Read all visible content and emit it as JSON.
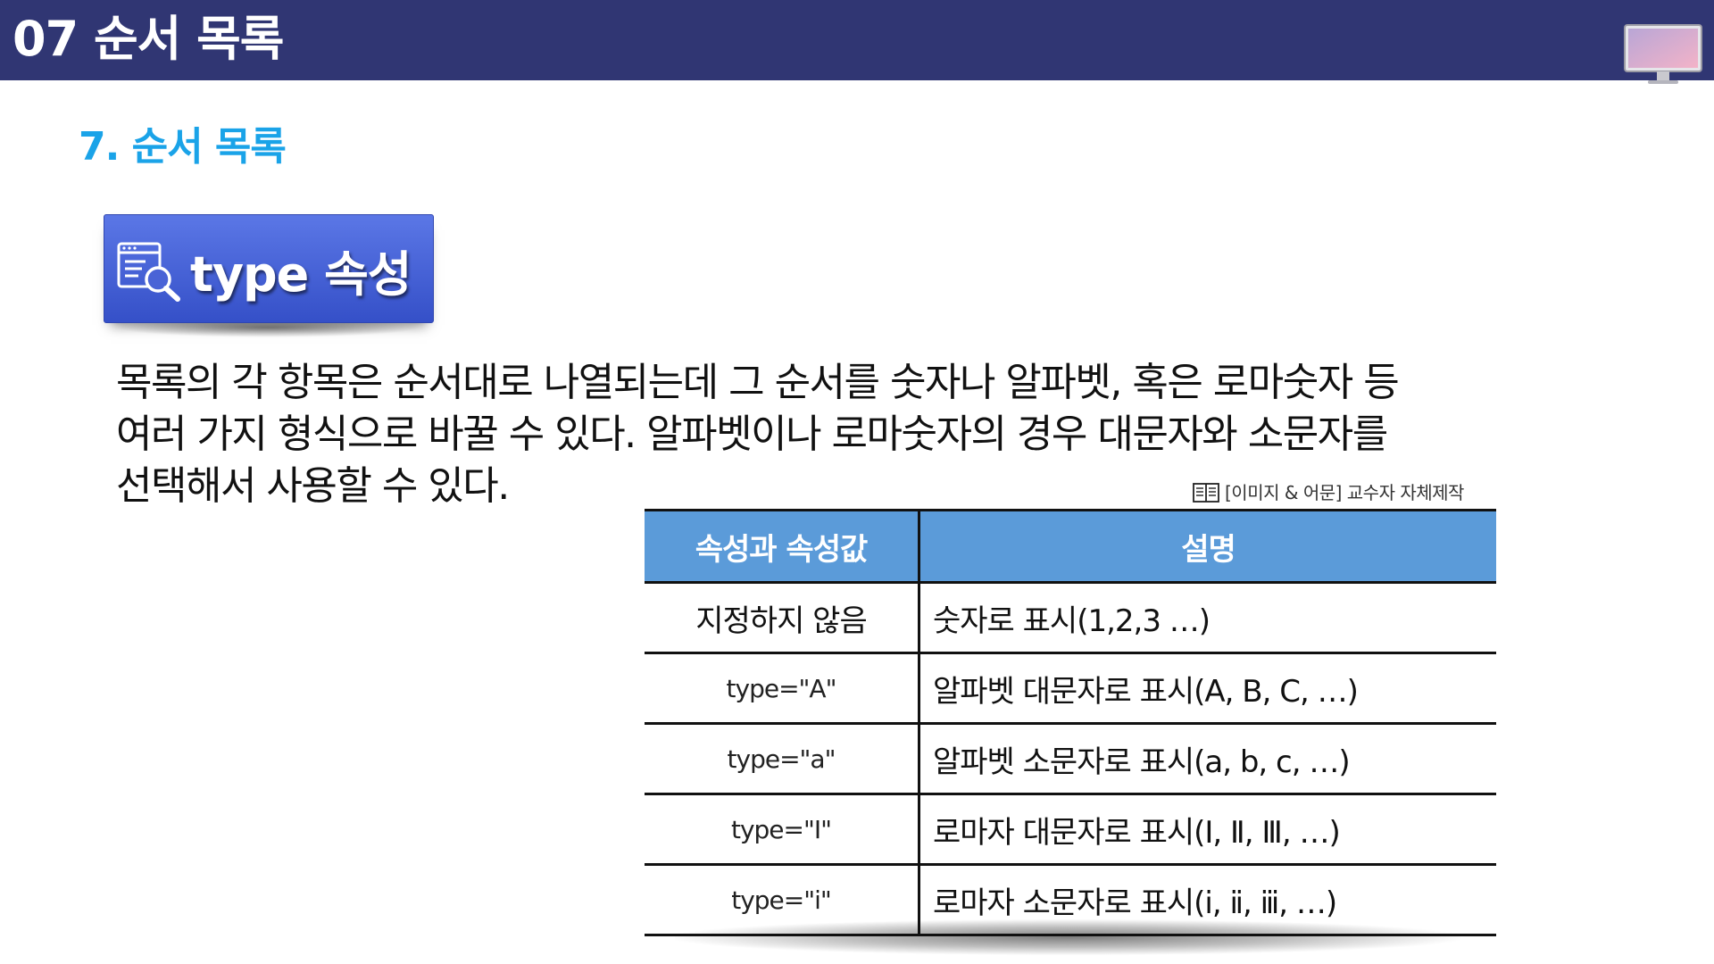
{
  "header": {
    "title": "07 순서 목록",
    "icon": "monitor-icon"
  },
  "section": {
    "title": "7. 순서 목록"
  },
  "badge": {
    "label": "type 속성",
    "icon": "document-search-icon",
    "color": "#4a63d6"
  },
  "body": {
    "lines": [
      "목록의 각 항목은 순서대로 나열되는데 그 순서를 숫자나 알파벳, 혹은 로마숫자 등",
      "여러 가지 형식으로 바꿀 수 있다. 알파벳이나 로마숫자의 경우 대문자와 소문자를",
      "선택해서 사용할 수 있다."
    ]
  },
  "source": {
    "text": "[이미지 & 어문] 교수자 자체제작",
    "icon": "book-icon"
  },
  "table": {
    "headers": [
      "속성과 속성값",
      "설명"
    ],
    "header_color": "#5b9bd9",
    "rows": [
      {
        "attr": "지정하지 않음",
        "desc": "숫자로 표시(1,2,3 …)"
      },
      {
        "attr": "type=\"A\"",
        "desc": "알파벳 대문자로 표시(A, B, C, …)"
      },
      {
        "attr": "type=\"a\"",
        "desc": "알파벳 소문자로 표시(a, b, c, …)"
      },
      {
        "attr": "type=\"I\"",
        "desc": "로마자 대문자로 표시(Ⅰ, Ⅱ, Ⅲ, …)"
      },
      {
        "attr": "type=\"i\"",
        "desc": "로마자 소문자로 표시(ⅰ, ⅱ, ⅲ, …)"
      }
    ]
  }
}
